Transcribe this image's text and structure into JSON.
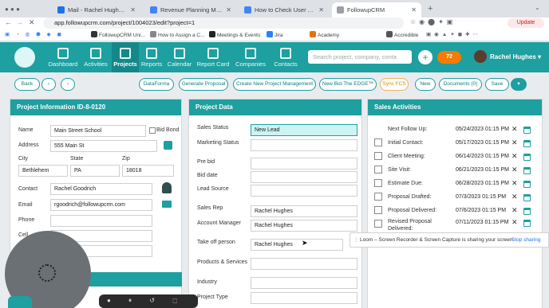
{
  "browser": {
    "tabs": [
      {
        "title": "Mail - Rachel Hughes - Outlook",
        "color": "#1a73e8"
      },
      {
        "title": "Revenue Planning Mastermind",
        "color": "#4285f4"
      },
      {
        "title": "How to Check User Activities",
        "color": "#4285f4"
      },
      {
        "title": "FollowupCRM",
        "color": "#9aa0a6"
      }
    ],
    "url": "app.followupcrm.com/project/1004023/edit?project=1",
    "update_label": "Update",
    "bookmarks": [
      "FollowupCRM Uni...",
      "How to Assign a C...",
      "Meetings & Events",
      "Jira",
      "Academy",
      "Accredible"
    ]
  },
  "nav": {
    "items": [
      "Dashboard",
      "Activities",
      "Projects",
      "Reports",
      "Calendar",
      "Report Card",
      "Companies",
      "Contacts"
    ],
    "search_placeholder": "Search project, company, conta",
    "notifications": "72",
    "user": "Rachel Hughes"
  },
  "toolbar": {
    "back": "Back",
    "buttons": [
      "DataForma",
      "Generate Proposal",
      "Create New Project Management",
      "New Bid-The EDGE™",
      "Sync FCS",
      "New",
      "Documents (0)",
      "Save"
    ]
  },
  "project_info": {
    "title": "Project Information ID-8-0120",
    "name_label": "Name",
    "name": "Main Street School",
    "bid_bond": "Bid Bond",
    "address_label": "Address",
    "address": "555 Main St",
    "city_label": "City",
    "city": "Bethlehem",
    "state_label": "State",
    "state": "PA",
    "zip_label": "Zip",
    "zip": "18018",
    "contact_label": "Contact",
    "contact": "Rachel Goodrich",
    "email_label": "Email",
    "email": "rgoodrich@followupcrm.com",
    "phone_label": "Phone",
    "cell_label": "Cell"
  },
  "project_data": {
    "title": "Project Data",
    "status_label": "Sales Status",
    "status": "New Lead",
    "marketing_label": "Marketing Status",
    "prebid_label": "Pre bid",
    "biddate_label": "Bid date",
    "leadsource_label": "Lead Source",
    "salesrep_label": "Sales Rep",
    "salesrep": "Rachel Hughes",
    "acctmgr_label": "Account Manager",
    "acctmgr": "Rachel Hughes",
    "takeoff_label": "Take off person",
    "takeoff": "Rachel Hughes",
    "products_label": "Products & Services",
    "industry_label": "Industry",
    "projtype_label": "Project Type"
  },
  "sales_activities": {
    "title": "Sales Activities",
    "followup_label": "Next Follow Up:",
    "followup": "05/24/2023 01:15 PM",
    "rows": [
      {
        "label": "Initial Contact:",
        "value": "05/17/2023 01:15 PM"
      },
      {
        "label": "Client Meeting:",
        "value": "06/14/2023 01:15 PM"
      },
      {
        "label": "Site Visit:",
        "value": "06/21/2023 01:15 PM"
      },
      {
        "label": "Estimate Due:",
        "value": "06/28/2023 01:15 PM"
      },
      {
        "label": "Proposal Drafted:",
        "value": "07/3/2023 01:15 PM"
      },
      {
        "label": "Proposal Delivered:",
        "value": "07/6/2023 01:15 PM"
      },
      {
        "label": "Revised Proposal Delivered:",
        "value": "07/11/2023 01:15 PM"
      }
    ]
  },
  "loom": {
    "message": "Loom – Screen Recorder & Screen Capture is sharing your screen.",
    "stop": "Stop sharing"
  }
}
